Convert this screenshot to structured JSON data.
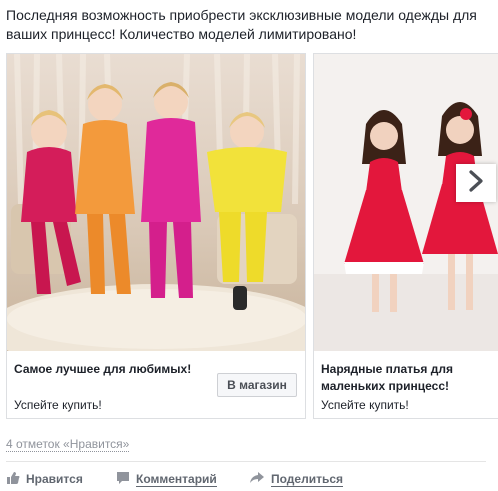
{
  "post": {
    "text": "Последняя возможность приобрести эксклюзивные модели одежды для ваших принцесс! Количество моделей лимитировано!"
  },
  "carousel": {
    "cards": [
      {
        "title": "Самое лучшее для любимых!",
        "subtitle": "Успейте купить!",
        "button_label": "В магазин"
      },
      {
        "title": "Нарядные платья для маленьких принцесс!",
        "subtitle": "Успейте купить!"
      }
    ]
  },
  "footer": {
    "likes_text": "4 отметок «Нравится»",
    "actions": {
      "like": "Нравится",
      "comment": "Комментарий",
      "share": "Поделиться"
    }
  },
  "icons": {
    "next": "chevron-right-icon",
    "like": "thumbs-up-icon",
    "comment": "speech-bubble-icon",
    "share": "share-arrow-icon"
  },
  "colors": {
    "link_gray": "#616770",
    "meta_gray": "#90949c",
    "border": "#dddfe2"
  }
}
